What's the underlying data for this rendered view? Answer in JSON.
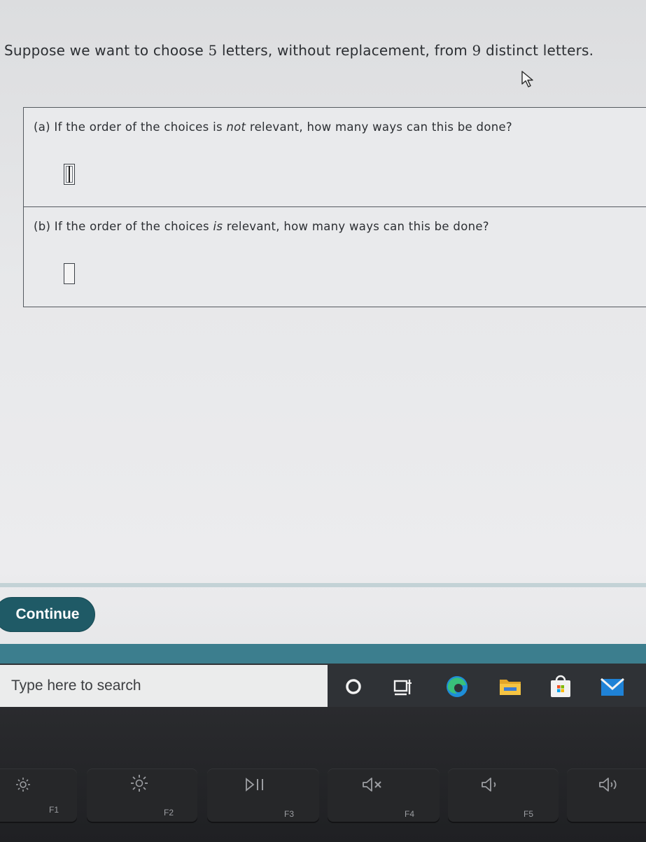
{
  "question": {
    "prefix": "Suppose we want to choose ",
    "k": "5",
    "middle": " letters, without replacement, from ",
    "n": "9",
    "suffix": " distinct letters."
  },
  "part_a": {
    "label": "(a)",
    "before": " If the order of the choices is ",
    "emph": "not",
    "after": " relevant, how many ways can this be done?",
    "answer": ""
  },
  "part_b": {
    "label": "(b)",
    "before": " If the order of the choices ",
    "emph": "is",
    "after": " relevant, how many ways can this be done?",
    "answer": ""
  },
  "continue_label": "Continue",
  "taskbar": {
    "search_placeholder": "Type here to search",
    "icons": [
      "cortana-icon",
      "task-view-icon",
      "edge-icon",
      "file-explorer-icon",
      "store-icon",
      "mail-icon"
    ]
  },
  "keyboard": {
    "keys": [
      {
        "label": "F1",
        "icon": "brightness-down-icon"
      },
      {
        "label": "F2",
        "icon": "brightness-up-icon"
      },
      {
        "label": "F3",
        "icon": "play-pause-icon"
      },
      {
        "label": "F4",
        "icon": "mute-icon"
      },
      {
        "label": "F5",
        "icon": "volume-down-icon"
      },
      {
        "label": "",
        "icon": "volume-up-icon"
      }
    ]
  },
  "colors": {
    "continue_bg": "#1f5a66",
    "teal_bar": "#3c7e8e",
    "taskbar_bg": "#2f3236"
  }
}
